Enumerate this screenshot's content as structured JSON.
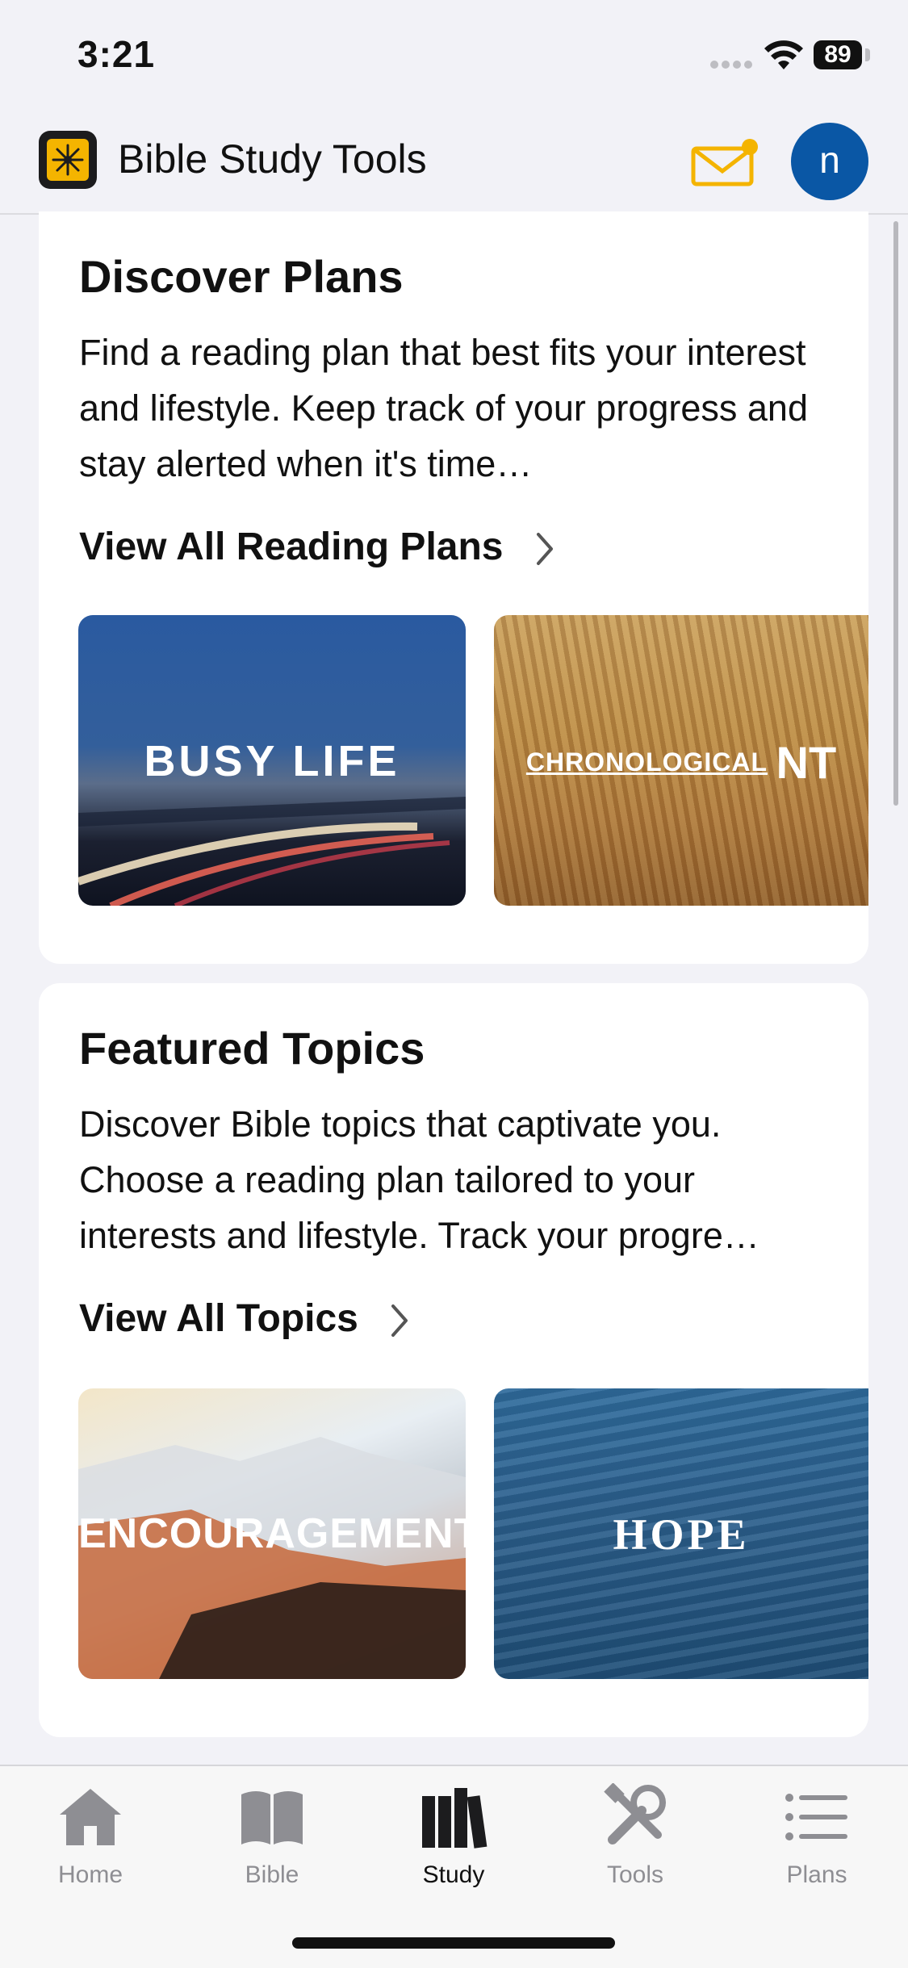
{
  "status_bar": {
    "time": "3:21",
    "battery": "89"
  },
  "header": {
    "app_title": "Bible Study Tools",
    "avatar_initial": "n"
  },
  "discover_plans": {
    "title": "Discover Plans",
    "description": "Find a reading plan that best fits your interest and lifestyle. Keep track of your progress and stay alerted when it's time…",
    "view_all": "View All Reading Plans",
    "tiles": [
      {
        "label": "BUSY LIFE"
      },
      {
        "label_small": "CHRONOLOGICAL",
        "label_big": "NT"
      }
    ]
  },
  "featured_topics": {
    "title": "Featured Topics",
    "description": "Discover Bible topics that captivate you. Choose a reading plan tailored to your interests and lifestyle. Track your progre…",
    "view_all": "View All Topics",
    "tiles": [
      {
        "label": "ENCOURAGEMENT"
      },
      {
        "label": "HOPE"
      }
    ]
  },
  "tabbar": {
    "items": [
      {
        "label": "Home",
        "icon": "house-icon",
        "active": false
      },
      {
        "label": "Bible",
        "icon": "book-icon",
        "active": false
      },
      {
        "label": "Study",
        "icon": "books-icon",
        "active": true
      },
      {
        "label": "Tools",
        "icon": "tools-icon",
        "active": false
      },
      {
        "label": "Plans",
        "icon": "list-icon",
        "active": false
      }
    ]
  },
  "colors": {
    "accent": "#0a57a5",
    "mail": "#f4b400",
    "notification_dot": "#f4b400"
  }
}
